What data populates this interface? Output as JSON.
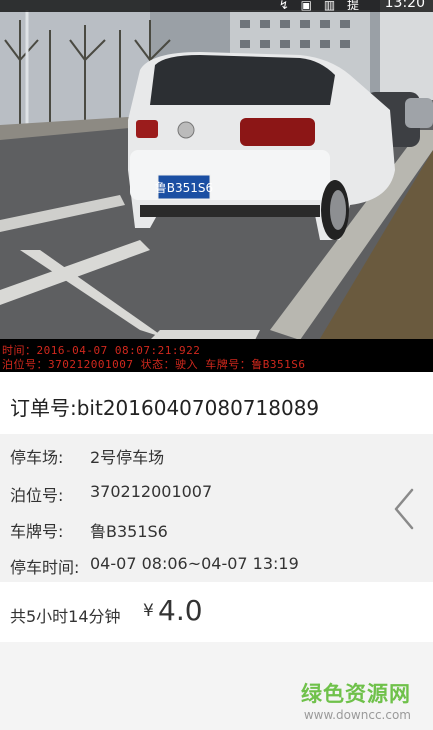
{
  "status_bar": {
    "icons": "↯ ▣ ▥ 提",
    "time": "13:20"
  },
  "photo": {
    "overlay_line1": "时间：2016-04-07  08:07:21:922",
    "overlay_line2": "泊位号：370212001007  状态：驶入  车牌号：鲁B351S6",
    "plate_text": "鲁B351S6"
  },
  "order": {
    "number_label": "订单号:bit20160407080718089"
  },
  "details": {
    "lot_label": "停车场:",
    "lot_value": "2号停车场",
    "berth_label": "泊位号:",
    "berth_value": "370212001007",
    "plate_label": "车牌号:",
    "plate_value": "鲁B351S6",
    "time_label": "停车时间:",
    "time_value": "04-07 08:06~04-07 13:19"
  },
  "summary": {
    "duration": "共5小时14分钟",
    "currency": "¥",
    "amount": "4.0"
  },
  "watermark": {
    "main": "绿色资源网",
    "url": "www.downcc.com"
  },
  "colors": {
    "overlay_text": "#d0281d",
    "watermark_green": "#6fc14a",
    "details_bg": "#f2f2f2"
  }
}
